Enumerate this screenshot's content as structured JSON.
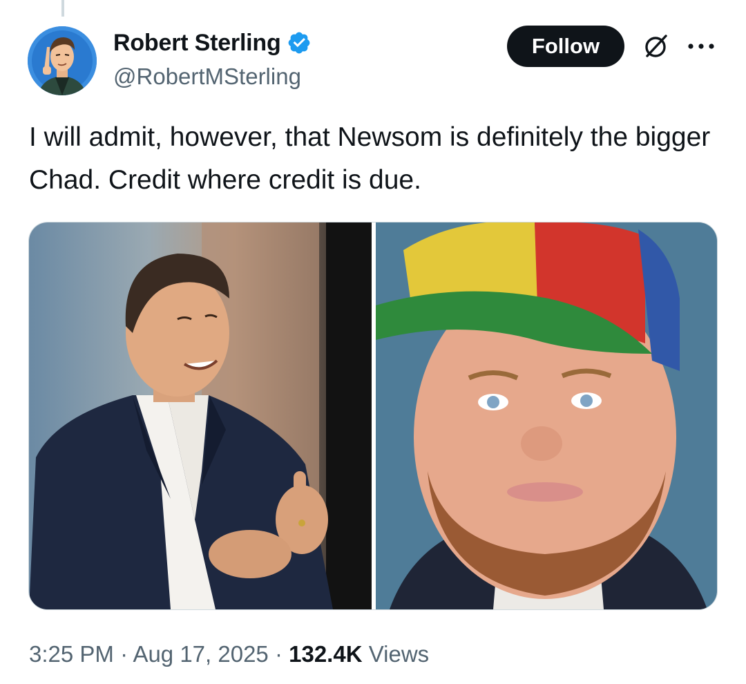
{
  "author": {
    "display_name": "Robert Sterling",
    "handle": "@RobertMSterling",
    "verified": true
  },
  "actions": {
    "follow_label": "Follow"
  },
  "tweet": {
    "text": "I will admit, however, that Newsom is definitely the bigger Chad. Credit where credit is due."
  },
  "media": {
    "image_count": 2
  },
  "meta": {
    "time": "3:25 PM",
    "separator": "·",
    "date": "Aug 17, 2025",
    "views_count": "132.4K",
    "views_label": "Views"
  },
  "colors": {
    "text_primary": "#0f1419",
    "text_secondary": "#536471",
    "verified_blue": "#1d9bf0",
    "follow_bg": "#0f1419",
    "border": "#cfd9de"
  },
  "icons": {
    "verified": "verified-badge-icon",
    "grok": "grok-icon",
    "more": "more-icon"
  }
}
